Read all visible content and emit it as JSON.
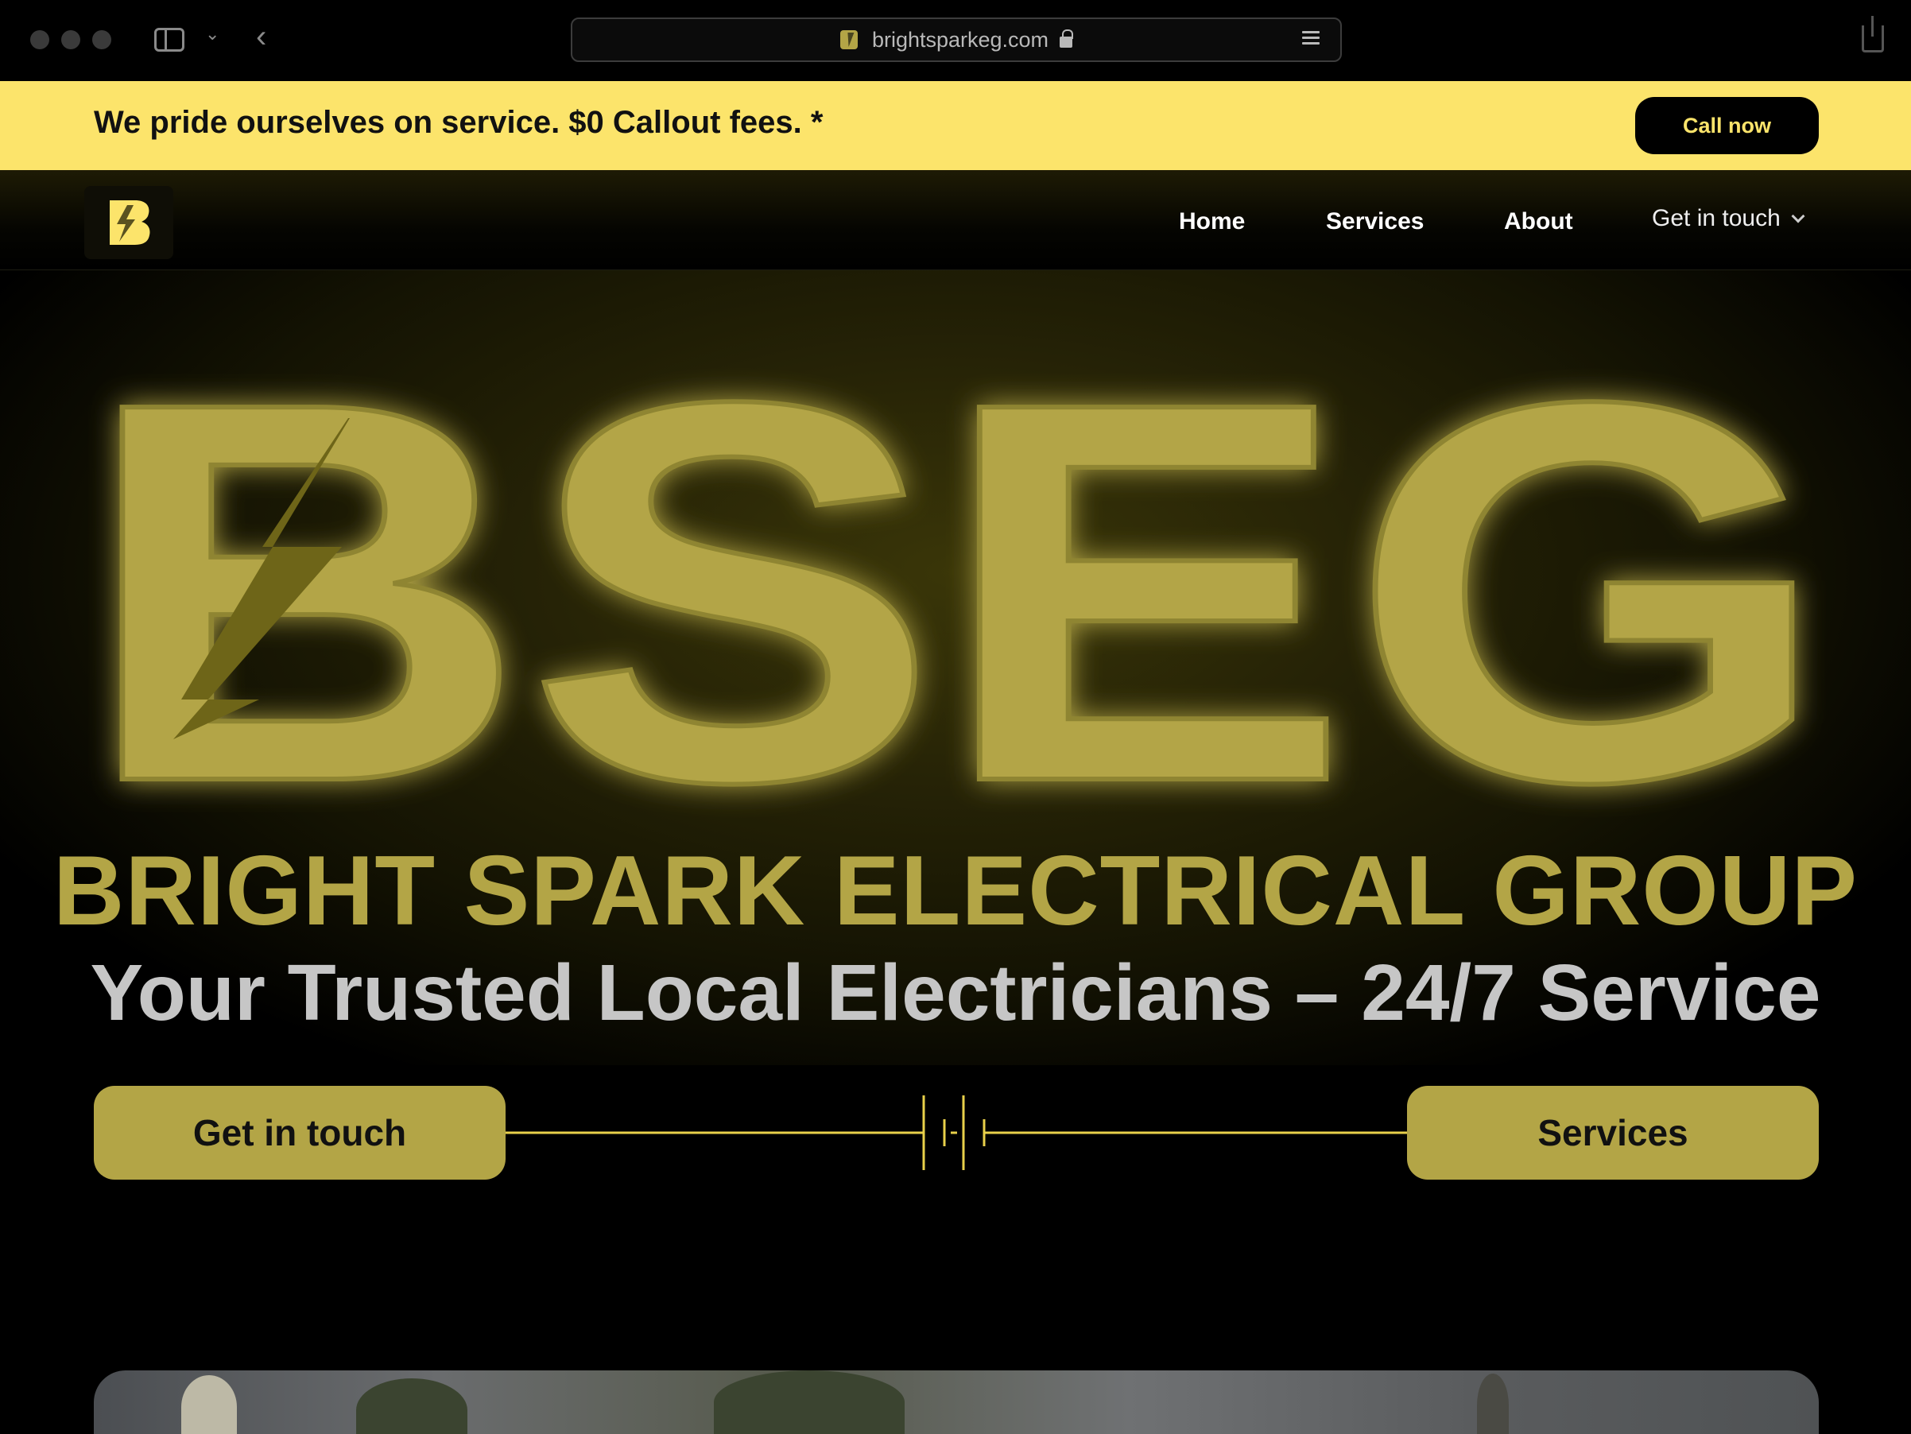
{
  "browser": {
    "url": "brightsparkeg.com"
  },
  "banner": {
    "text": "We pride ourselves on service. $0 Callout fees. *",
    "call_label": "Call now"
  },
  "nav": {
    "items": [
      {
        "label": "Home"
      },
      {
        "label": "Services"
      },
      {
        "label": "About"
      },
      {
        "label": "Get in touch"
      }
    ]
  },
  "hero": {
    "logo_text": "BSEG",
    "brand_name": "BRIGHT SPARK ELECTRICAL GROUP",
    "tagline": "Your Trusted Local Electricians – 24/7 Service"
  },
  "cta": {
    "left_label": "Get in touch",
    "right_label": "Services"
  },
  "colors": {
    "accent_yellow": "#fce46b",
    "brand_olive": "#b3a546",
    "background": "#000000"
  },
  "icons": [
    "sidebar-icon",
    "back-icon",
    "lock-icon",
    "reader-icon",
    "share-icon",
    "lightning-icon",
    "chevron-down-icon",
    "battery-symbol-icon"
  ]
}
